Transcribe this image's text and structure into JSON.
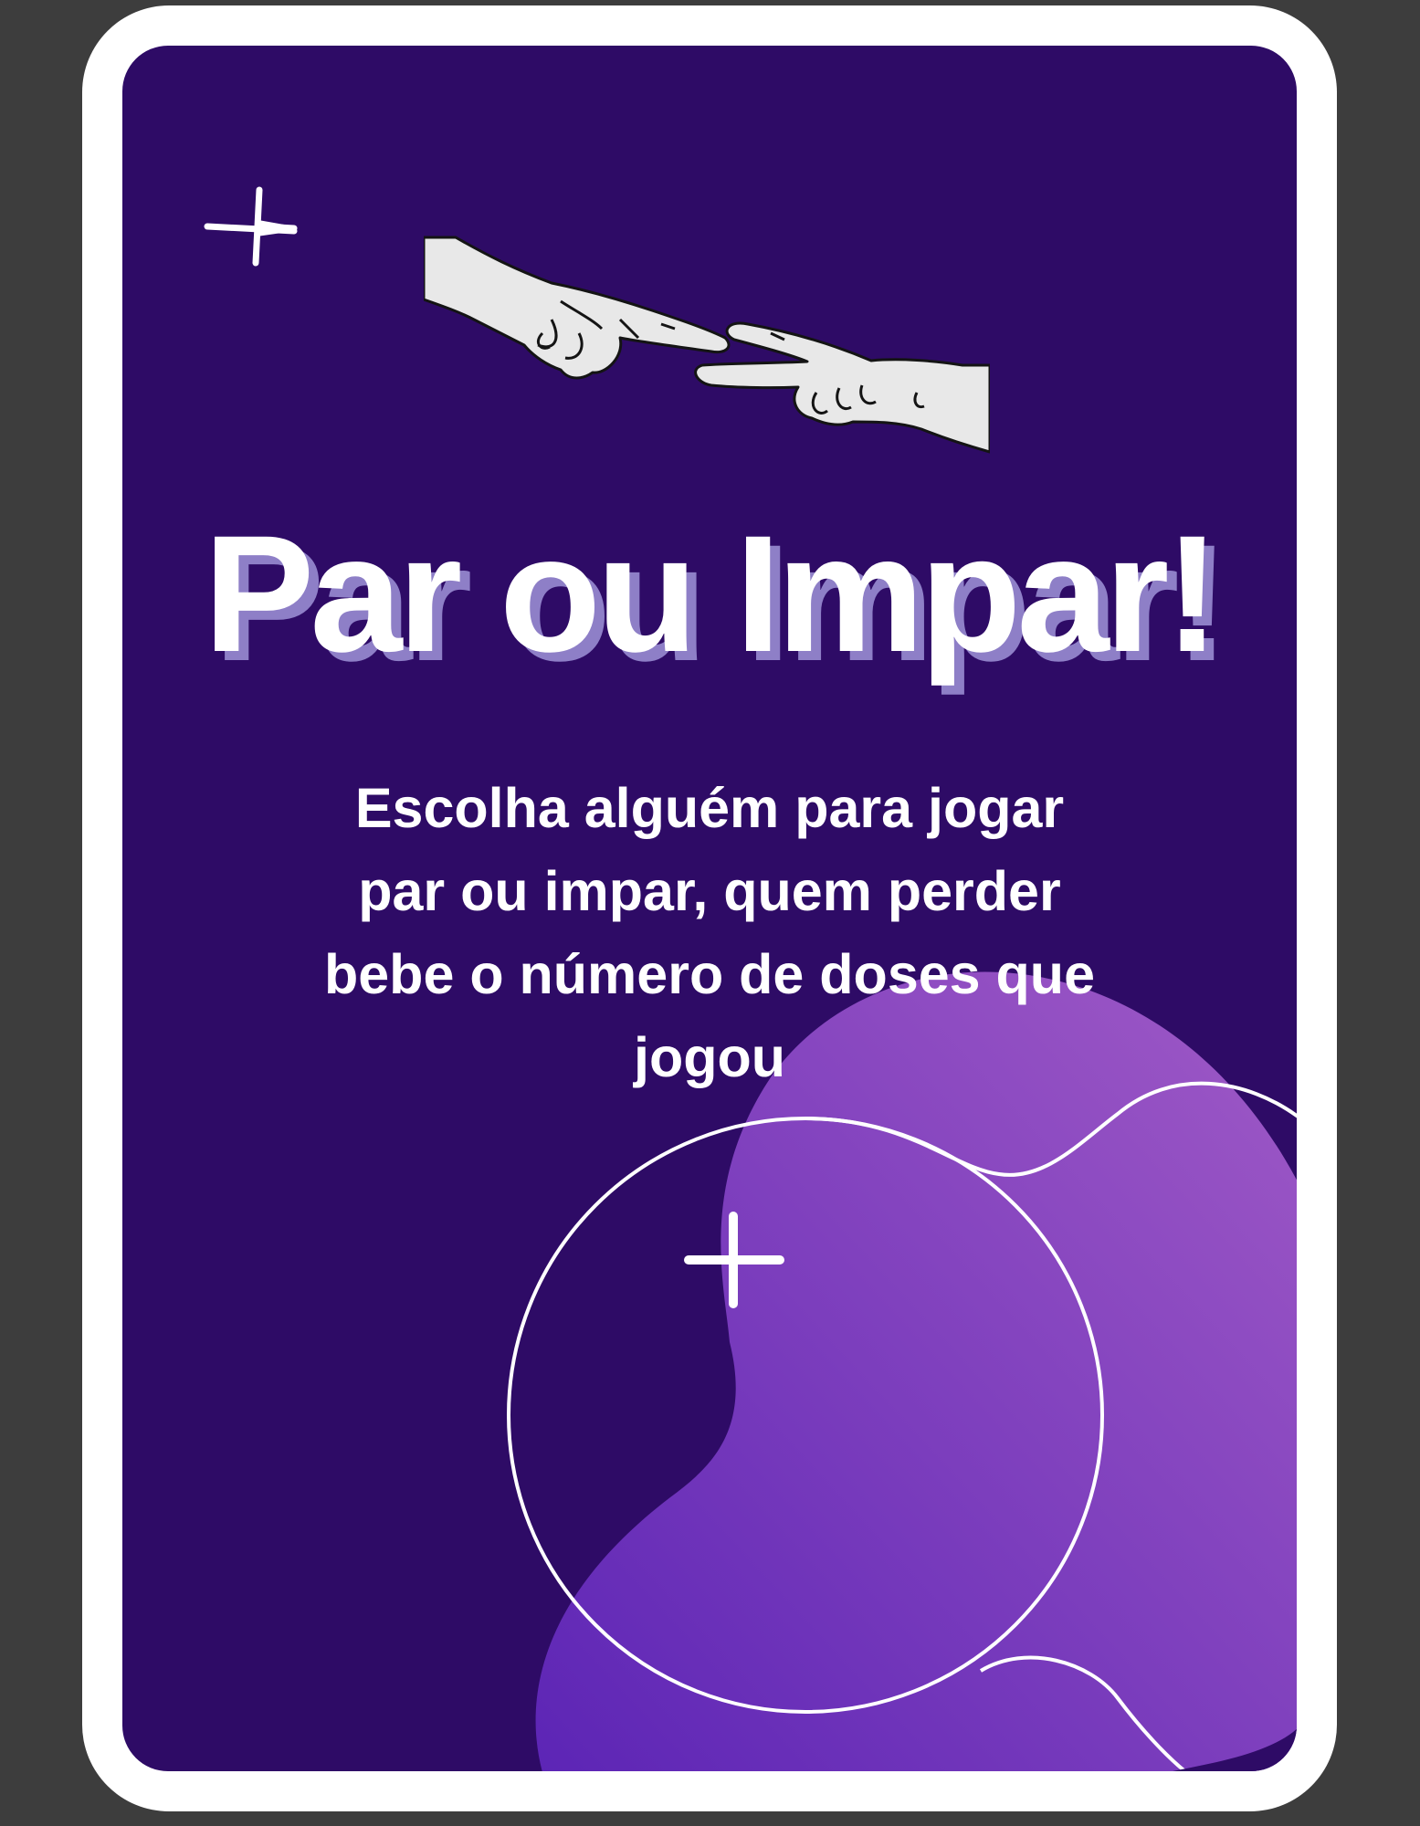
{
  "card": {
    "title": "Par ou Impar!",
    "description": "Escolha alguém para jogar par ou impar, quem perder bebe o número de doses que jogou"
  },
  "colors": {
    "page_background": "#3d3d3d",
    "card_border": "#ffffff",
    "card_background": "#2e0b66",
    "blob_gradient_start": "#5d27b8",
    "blob_gradient_end": "#9b59c4",
    "title_text": "#ffffff",
    "title_shadow": "#8e7fc7"
  },
  "icons": [
    "sparkle-cross-icon",
    "pointing-hand-icon",
    "peace-sign-hand-icon"
  ]
}
